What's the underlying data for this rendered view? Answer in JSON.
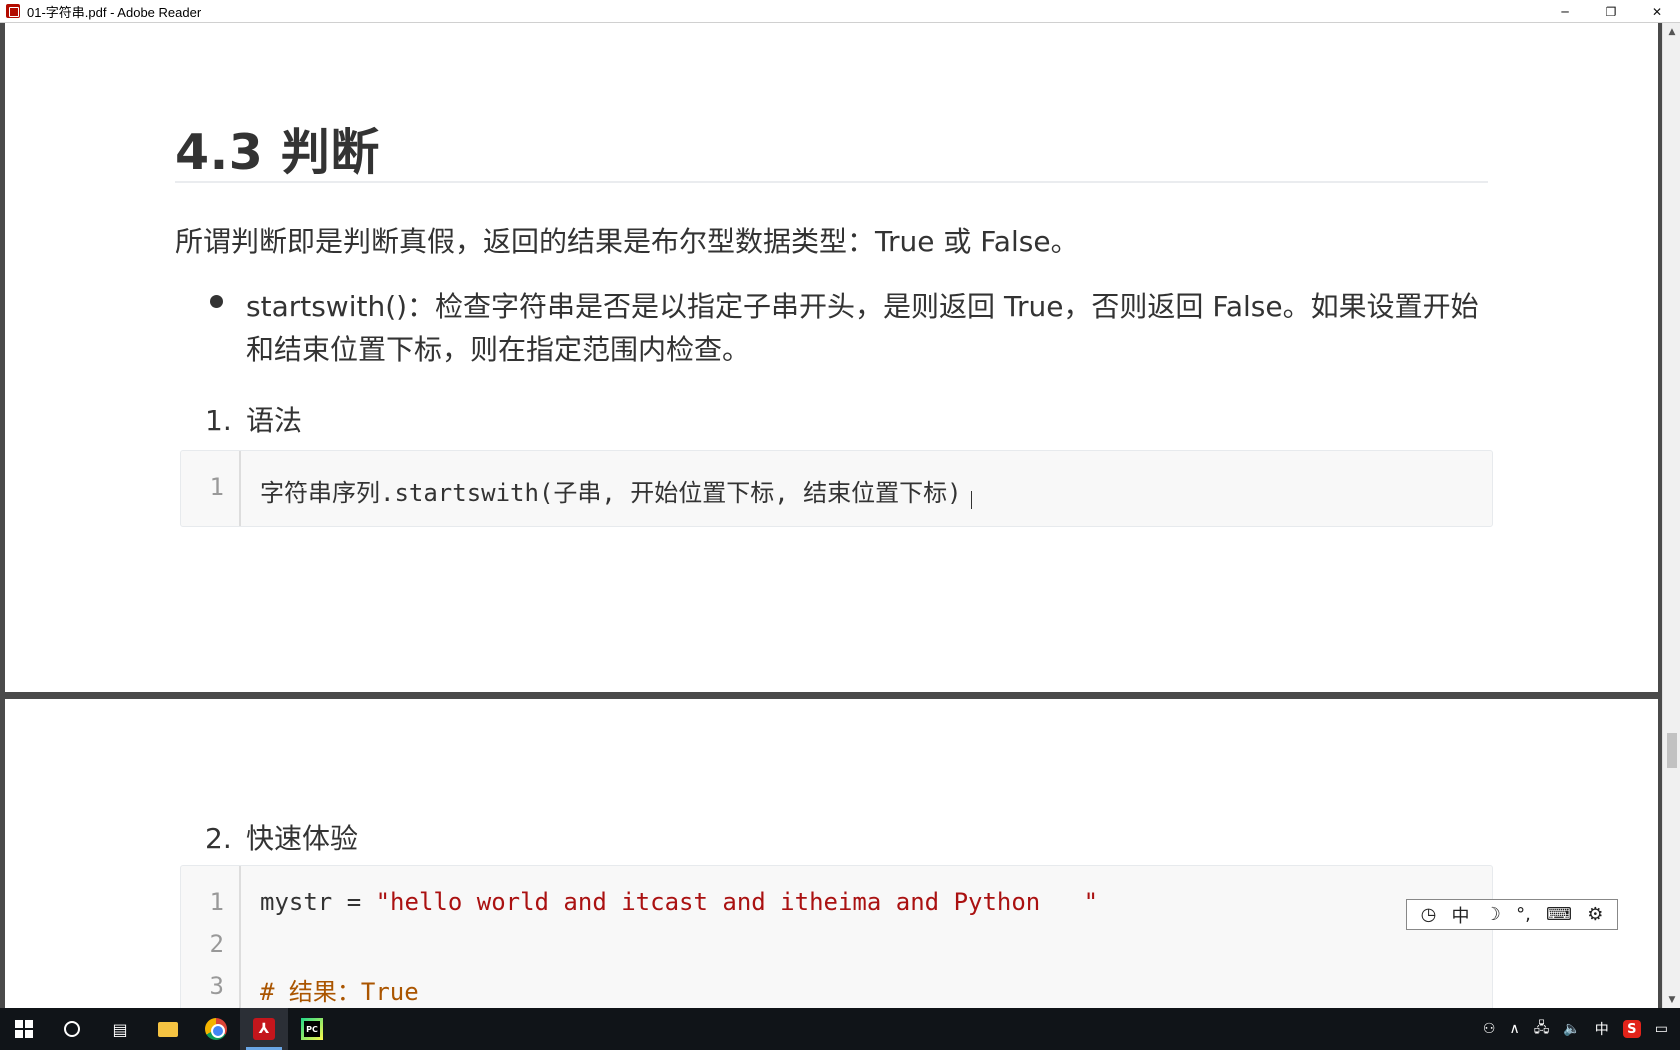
{
  "window": {
    "title": "01-字符串.pdf - Adobe Reader",
    "minimize": "─",
    "restore": "❐",
    "close": "✕"
  },
  "document": {
    "section_heading": "4.3 判断",
    "intro": "所谓判断即是判断真假，返回的结果是布尔型数据类型：True 或 False。",
    "bullet": "startswith()：检查字符串是否是以指定子串开头，是则返回 True，否则返回 False。如果设置开始和结束位置下标，则在指定范围内检查。",
    "ol": [
      {
        "num": "1.",
        "label": "语法"
      },
      {
        "num": "2.",
        "label": "快速体验"
      }
    ],
    "syntax_code": [
      {
        "ln": "1",
        "text": "字符串序列.startswith(子串, 开始位置下标, 结束位置下标)"
      }
    ],
    "example_code": [
      {
        "ln": "1",
        "pre": "mystr = ",
        "str": "\"hello world and itcast and itheima and Python   \""
      },
      {
        "ln": "2",
        "pre": "",
        "str": ""
      },
      {
        "ln": "3",
        "cmt": "# 结果：True"
      }
    ]
  },
  "ime_toolbar": {
    "items": [
      "中",
      "☽",
      "°,",
      "⌨",
      "⚙"
    ]
  },
  "scrollbar": {
    "up": "▲",
    "down": "▼"
  },
  "tray": {
    "lang": "中",
    "sogou": "S"
  }
}
